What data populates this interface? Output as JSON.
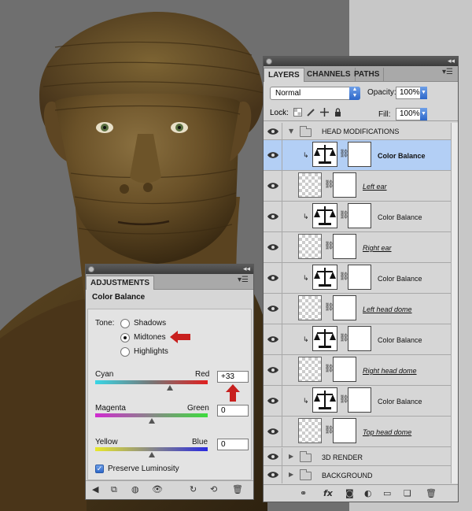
{
  "layers_panel": {
    "tabs": [
      "LAYERS",
      "CHANNELS",
      "PATHS"
    ],
    "blend_mode": "Normal",
    "opacity_label": "Opacity:",
    "opacity_value": "100%",
    "lock_label": "Lock:",
    "fill_label": "Fill:",
    "fill_value": "100%",
    "group_head": "HEAD MODIFICATIONS",
    "layers": [
      {
        "name": "Color Balance",
        "kind": "adjustment",
        "selected": true
      },
      {
        "name": "Left ear",
        "kind": "pixel"
      },
      {
        "name": "Color Balance",
        "kind": "adjustment"
      },
      {
        "name": "Right ear",
        "kind": "pixel"
      },
      {
        "name": "Color Balance",
        "kind": "adjustment"
      },
      {
        "name": "Left head dome",
        "kind": "pixel"
      },
      {
        "name": "Color Balance",
        "kind": "adjustment"
      },
      {
        "name": "Right head dome",
        "kind": "pixel"
      },
      {
        "name": "Color Balance",
        "kind": "adjustment"
      },
      {
        "name": "Top head dome",
        "kind": "pixel"
      }
    ],
    "group_3d": "3D RENDER",
    "group_bg": "BACKGROUND"
  },
  "adjustments_panel": {
    "tab": "ADJUSTMENTS",
    "title": "Color Balance",
    "tone_label": "Tone:",
    "tone_options": [
      "Shadows",
      "Midtones",
      "Highlights"
    ],
    "selected_tone": "Midtones",
    "sliders": [
      {
        "left": "Cyan",
        "right": "Red",
        "value": "+33"
      },
      {
        "left": "Magenta",
        "right": "Green",
        "value": "0"
      },
      {
        "left": "Yellow",
        "right": "Blue",
        "value": "0"
      }
    ],
    "preserve_label": "Preserve Luminosity",
    "preserve_checked": true
  },
  "colors": {
    "accent_arrow": "#c8201e",
    "selected_row": "#b3cff5"
  }
}
